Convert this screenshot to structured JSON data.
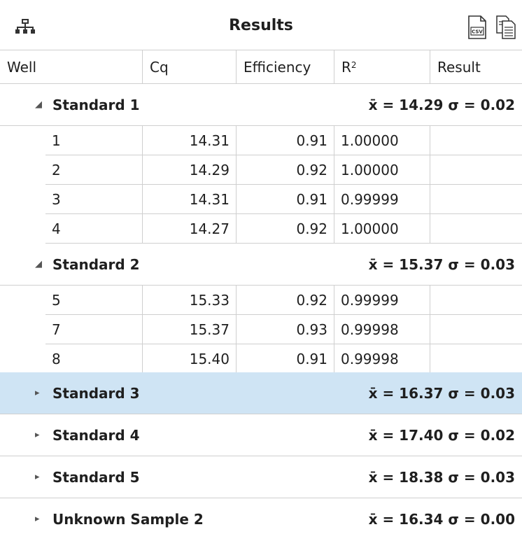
{
  "title": "Results",
  "icons": {
    "hierarchy": "hierarchy-icon",
    "csv": "csv-export-icon",
    "copy": "copy-icon",
    "expanded": "triangle-expanded-icon",
    "collapsed": "triangle-collapsed-icon"
  },
  "csv_label": "CSV",
  "columns": {
    "well": "Well",
    "cq": "Cq",
    "efficiency": "Efficiency",
    "r2_base": "R",
    "r2_sup": "2",
    "result": "Result"
  },
  "groups": [
    {
      "name": "Standard 1",
      "stats": "x̄ = 14.29 σ = 0.02",
      "expanded": true,
      "rows": [
        {
          "well": "1",
          "cq": "14.31",
          "efficiency": "0.91",
          "r2": "1.00000",
          "result": ""
        },
        {
          "well": "2",
          "cq": "14.29",
          "efficiency": "0.92",
          "r2": "1.00000",
          "result": ""
        },
        {
          "well": "3",
          "cq": "14.31",
          "efficiency": "0.91",
          "r2": "0.99999",
          "result": ""
        },
        {
          "well": "4",
          "cq": "14.27",
          "efficiency": "0.92",
          "r2": "1.00000",
          "result": ""
        }
      ]
    },
    {
      "name": "Standard 2",
      "stats": "x̄ = 15.37 σ = 0.03",
      "expanded": true,
      "rows": [
        {
          "well": "5",
          "cq": "15.33",
          "efficiency": "0.92",
          "r2": "0.99999",
          "result": ""
        },
        {
          "well": "7",
          "cq": "15.37",
          "efficiency": "0.93",
          "r2": "0.99998",
          "result": ""
        },
        {
          "well": "8",
          "cq": "15.40",
          "efficiency": "0.91",
          "r2": "0.99998",
          "result": ""
        }
      ]
    },
    {
      "name": "Standard 3",
      "stats": "x̄ = 16.37 σ = 0.03",
      "expanded": false,
      "selected": true,
      "rows": []
    },
    {
      "name": "Standard 4",
      "stats": "x̄ = 17.40 σ = 0.02",
      "expanded": false,
      "rows": []
    },
    {
      "name": "Standard 5",
      "stats": "x̄ = 18.38 σ = 0.03",
      "expanded": false,
      "rows": []
    },
    {
      "name": "Unknown Sample 2",
      "stats": "x̄ = 16.34 σ = 0.00",
      "expanded": false,
      "rows": []
    }
  ],
  "colors": {
    "selected_row": "#cfe4f4",
    "grid_line": "#cfcfcf",
    "text": "#1f1f1f",
    "toggle": "#555555"
  }
}
